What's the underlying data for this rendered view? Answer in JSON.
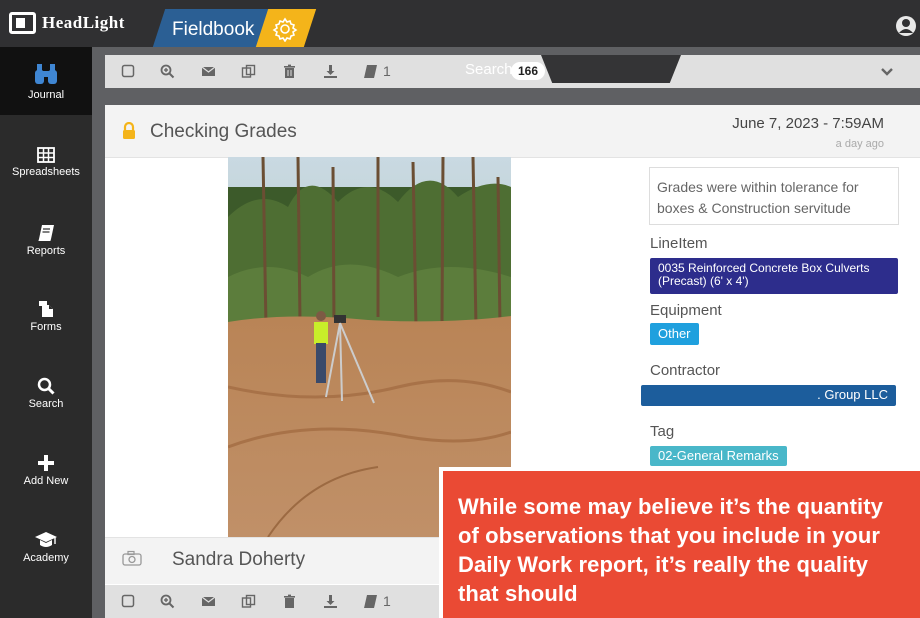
{
  "app": {
    "brand": "HeadLight",
    "module": "Fieldbook"
  },
  "nav": [
    {
      "label": "Journal",
      "icon": "binoculars-icon",
      "active": true
    },
    {
      "label": "Spreadsheets",
      "icon": "grid-icon"
    },
    {
      "label": "Reports",
      "icon": "book-icon"
    },
    {
      "label": "Forms",
      "icon": "forms-icon"
    },
    {
      "label": "Search",
      "icon": "search-icon"
    },
    {
      "label": "Add New",
      "icon": "plus-icon"
    },
    {
      "label": "Academy",
      "icon": "graduation-cap-icon"
    }
  ],
  "toolbar": {
    "report_count": "1",
    "search_label": "Search",
    "search_count": "166"
  },
  "entry": {
    "title": "Checking Grades",
    "date": "June 7, 2023 - 7:59AM",
    "relative_time": "a day ago",
    "description": "Grades were within tolerance for boxes & Construction servitude",
    "fields": {
      "line_item_label": "LineItem",
      "line_item_value": "0035 Reinforced Concrete Box Culverts (Precast) (6' x 4')",
      "equipment_label": "Equipment",
      "equipment_value": "Other",
      "contractor_label": "Contractor",
      "contractor_value": ". Group LLC",
      "tag_label": "Tag",
      "tag_value": "02-General Remarks"
    },
    "author": "Sandra Doherty"
  },
  "bottom_toolbar": {
    "report_count": "1"
  },
  "callout": {
    "text": "While some may believe it’s the quantity of observations that you include in your Daily Work report, it’s really the quality that should"
  },
  "colors": {
    "brand_blue": "#2b5f94",
    "gear_yellow": "#f4b41a",
    "line_item_chip": "#2d2d8c",
    "equipment_chip": "#1fa0de",
    "contractor_chip": "#1c5d9c",
    "tag_chip": "#49b7c9",
    "callout_red": "#ea4a34",
    "lock_yellow": "#f4b41a"
  }
}
